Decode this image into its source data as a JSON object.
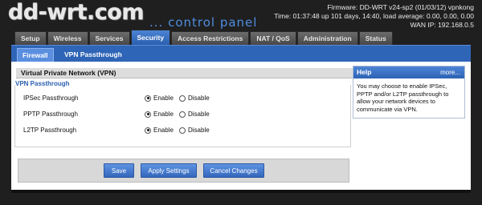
{
  "header": {
    "logo_main": "dd-wrt",
    "logo_dot": ".",
    "logo_tld": "com",
    "panel_title": "... control panel",
    "firmware": "Firmware: DD-WRT v24-sp2 (01/03/12) vpnkong",
    "time": "Time: 01:37:48 up 101 days, 14:40, load average: 0.00, 0.00, 0.00",
    "wan_ip": "WAN IP: 192.168.0.5"
  },
  "tabs": [
    {
      "label": "Setup"
    },
    {
      "label": "Wireless"
    },
    {
      "label": "Services"
    },
    {
      "label": "Security"
    },
    {
      "label": "Access Restrictions"
    },
    {
      "label": "NAT / QoS"
    },
    {
      "label": "Administration"
    },
    {
      "label": "Status"
    }
  ],
  "subtabs": [
    {
      "label": "Firewall"
    },
    {
      "label": "VPN Passthrough"
    }
  ],
  "section": {
    "title": "Virtual Private Network (VPN)",
    "legend": "VPN Passthrough",
    "rows": [
      {
        "label": "IPSec Passthrough",
        "enable": "Enable",
        "disable": "Disable"
      },
      {
        "label": "PPTP Passthrough",
        "enable": "Enable",
        "disable": "Disable"
      },
      {
        "label": "L2TP Passthrough",
        "enable": "Enable",
        "disable": "Disable"
      }
    ]
  },
  "buttons": {
    "save": "Save",
    "apply": "Apply Settings",
    "cancel": "Cancel Changes"
  },
  "help": {
    "title": "Help",
    "more": "more...",
    "text": "You may choose to enable IPSec, PPTP and/or L2TP passthrough to allow your network devices to communicate via VPN."
  },
  "colors": {
    "accent_blue": "#2f65b7",
    "background": "#1f1f1f"
  }
}
